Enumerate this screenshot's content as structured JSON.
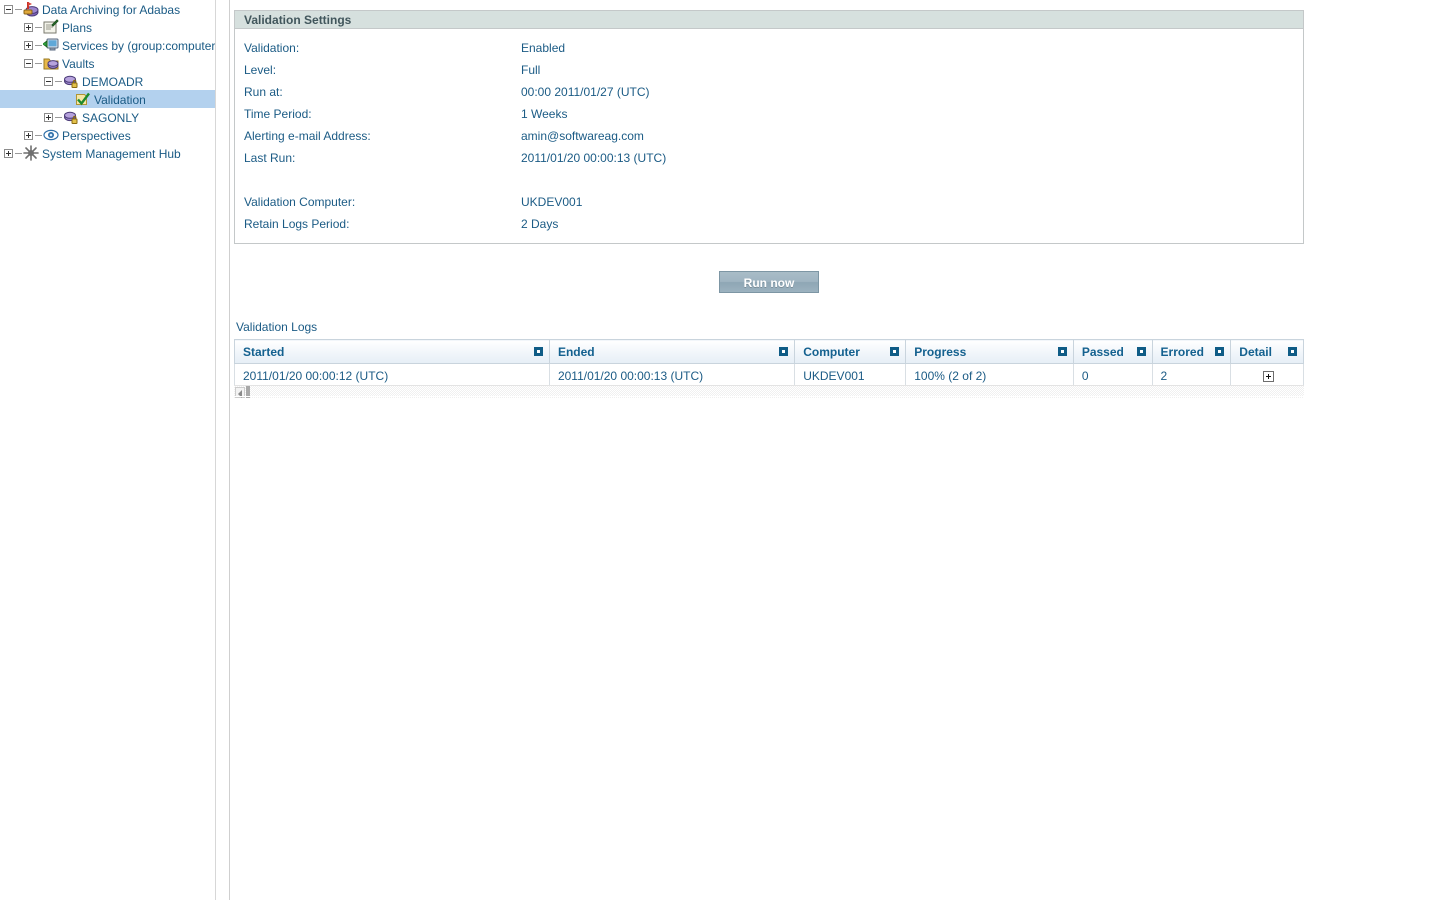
{
  "sidebar": {
    "nodes": [
      {
        "label": "Data Archiving for Adabas",
        "icon": "archive-node-icon",
        "indent": 0,
        "twist": "minus",
        "selected": false
      },
      {
        "label": "Plans",
        "icon": "plans-icon",
        "indent": 1,
        "twist": "plus",
        "selected": false
      },
      {
        "label": "Services by (group:computer:dae",
        "icon": "services-computer-icon",
        "indent": 1,
        "twist": "plus",
        "selected": false
      },
      {
        "label": "Vaults",
        "icon": "vaults-folder-icon",
        "indent": 1,
        "twist": "minus",
        "selected": false
      },
      {
        "label": "DEMOADR",
        "icon": "vault-locked-icon",
        "indent": 2,
        "twist": "minus",
        "selected": false
      },
      {
        "label": "Validation",
        "icon": "validation-check-icon",
        "indent": 3,
        "twist": "none",
        "selected": true
      },
      {
        "label": "SAGONLY",
        "icon": "vault-locked-icon",
        "indent": 2,
        "twist": "plus",
        "selected": false
      },
      {
        "label": "Perspectives",
        "icon": "perspectives-eye-icon",
        "indent": 1,
        "twist": "plus",
        "selected": false
      },
      {
        "label": "System Management Hub",
        "icon": "system-management-hub-icon",
        "indent": 0,
        "twist": "plus",
        "selected": false
      }
    ]
  },
  "settings_panel": {
    "title": "Validation Settings",
    "fields": [
      {
        "label": "Validation:",
        "value": "Enabled"
      },
      {
        "label": "Level:",
        "value": "Full"
      },
      {
        "label": "Run at:",
        "value": "00:00  2011/01/27 (UTC)"
      },
      {
        "label": "Time Period:",
        "value": "1 Weeks"
      },
      {
        "label": "Alerting e-mail Address:",
        "value": "amin@softwareag.com"
      },
      {
        "label": "Last Run:",
        "value": "2011/01/20 00:00:13 (UTC)"
      },
      {
        "label": "Validation Computer:",
        "value": "UKDEV001"
      },
      {
        "label": "Retain Logs Period:",
        "value": "2 Days"
      }
    ]
  },
  "actions": {
    "run_now_label": "Run now"
  },
  "logs": {
    "title": "Validation Logs",
    "columns": [
      "Started",
      "Ended",
      "Computer",
      "Progress",
      "Passed",
      "Errored",
      "Detail"
    ],
    "rows": [
      {
        "started": "2011/01/20 00:00:12 (UTC)",
        "ended": "2011/01/20 00:00:13 (UTC)",
        "computer": "UKDEV001",
        "progress": "100% (2 of 2)",
        "passed": "0",
        "errored": "2",
        "detail": ""
      }
    ]
  },
  "colors": {
    "link_text": "#1b5b85",
    "panel_header_bg": "#d6e0de",
    "selection_bg": "#b3d1ee",
    "grid_header_text": "#14618f"
  }
}
